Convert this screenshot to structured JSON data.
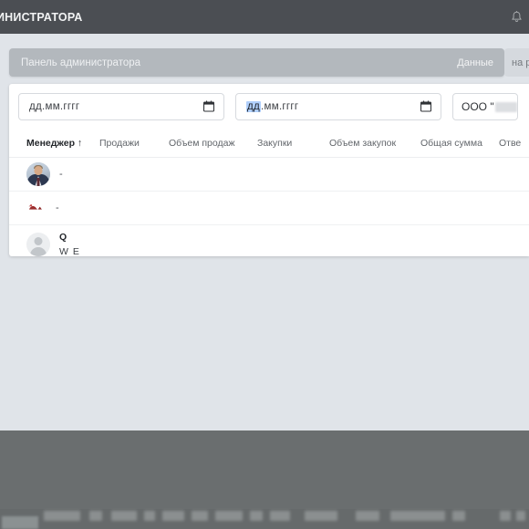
{
  "appbar": {
    "title_truncated": "ИНИСТРАТОРА",
    "bell_icon": "bell-icon"
  },
  "crumbbar": {
    "title": "Панель администратора",
    "tab_data": "Данные",
    "tab_right_truncated": "на р"
  },
  "filters": {
    "date_from": {
      "placeholder": "дд.мм.гггг",
      "value": "дд.мм.гггг",
      "selected_segment": "",
      "rest": "дд.мм.гггг",
      "icon": "calendar-icon"
    },
    "date_to": {
      "placeholder": "дд.мм.гггг",
      "value": "дд.мм.гггг",
      "selected_segment": "дд",
      "rest": ".мм.гггг",
      "icon": "calendar-icon"
    },
    "company": {
      "value": "ООО \"",
      "redacted": true
    }
  },
  "table": {
    "columns": [
      {
        "label": "Менеджер",
        "sorted": true,
        "sort_icon": "↑"
      },
      {
        "label": "Продажи",
        "sorted": false,
        "sort_icon": ""
      },
      {
        "label": "Объем продаж",
        "sorted": false,
        "sort_icon": ""
      },
      {
        "label": "Закупки",
        "sorted": false,
        "sort_icon": ""
      },
      {
        "label": "Объем закупок",
        "sorted": false,
        "sort_icon": ""
      },
      {
        "label": "Общая сумма",
        "sorted": false,
        "sort_icon": ""
      },
      {
        "label": "Отве",
        "sorted": false,
        "sort_icon": ""
      }
    ],
    "rows": [
      {
        "avatar_type": "photo-avatar",
        "manager_label": "-",
        "line1": "",
        "line2": ""
      },
      {
        "avatar_type": "broken-image-icon",
        "manager_label": "-",
        "line1": "",
        "line2": ""
      },
      {
        "avatar_type": "silhouette-avatar",
        "manager_label": "",
        "line1": "Q",
        "line2": "W E"
      }
    ]
  },
  "colors": {
    "appbar_bg": "#4b4e53",
    "page_bg": "#e0e4e9",
    "crumbbar_bg": "#b3b8bd",
    "card_bg": "#ffffff",
    "selection_blue": "#b0cffb",
    "os_overlay_bg": "#6a6e6f"
  }
}
